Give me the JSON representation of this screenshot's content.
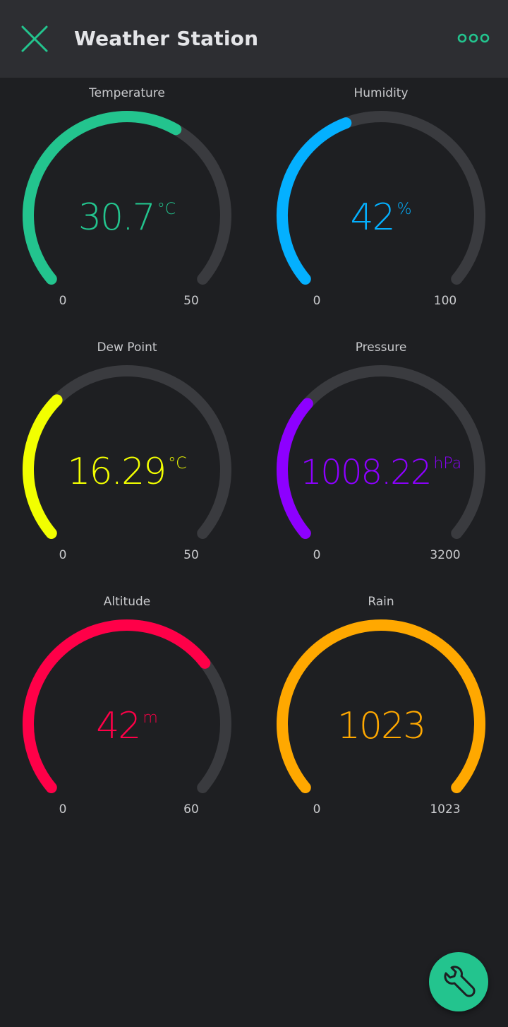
{
  "app": {
    "title": "Weather Station"
  },
  "icons": {
    "close": "close-icon",
    "more": "more-horizontal-icon",
    "fab": "wrench-icon"
  },
  "colors": {
    "accent": "#23c48e",
    "track": "#3a3b3f",
    "background": "#1e1f22",
    "topbar": "#2d2e32"
  },
  "gauges": [
    {
      "label": "Temperature",
      "value": "30.7",
      "unit": "°C",
      "min": "0",
      "max": "50",
      "fraction": 0.614,
      "color": "#23c48e"
    },
    {
      "label": "Humidity",
      "value": "42",
      "unit": "%",
      "min": "0",
      "max": "100",
      "fraction": 0.42,
      "color": "#04b0ff"
    },
    {
      "label": "Dew Point",
      "value": "16.29",
      "unit": "°C",
      "min": "0",
      "max": "50",
      "fraction": 0.326,
      "color": "#f2ff00"
    },
    {
      "label": "Pressure",
      "value": "1008.22",
      "unit": "hPa",
      "min": "0",
      "max": "3200",
      "fraction": 0.315,
      "color": "#8d00ff"
    },
    {
      "label": "Altitude",
      "value": "42",
      "unit": "m",
      "min": "0",
      "max": "60",
      "fraction": 0.7,
      "color": "#ff0048"
    },
    {
      "label": "Rain",
      "value": "1023",
      "unit": "",
      "min": "0",
      "max": "1023",
      "fraction": 1.0,
      "color": "#ffa800"
    }
  ]
}
